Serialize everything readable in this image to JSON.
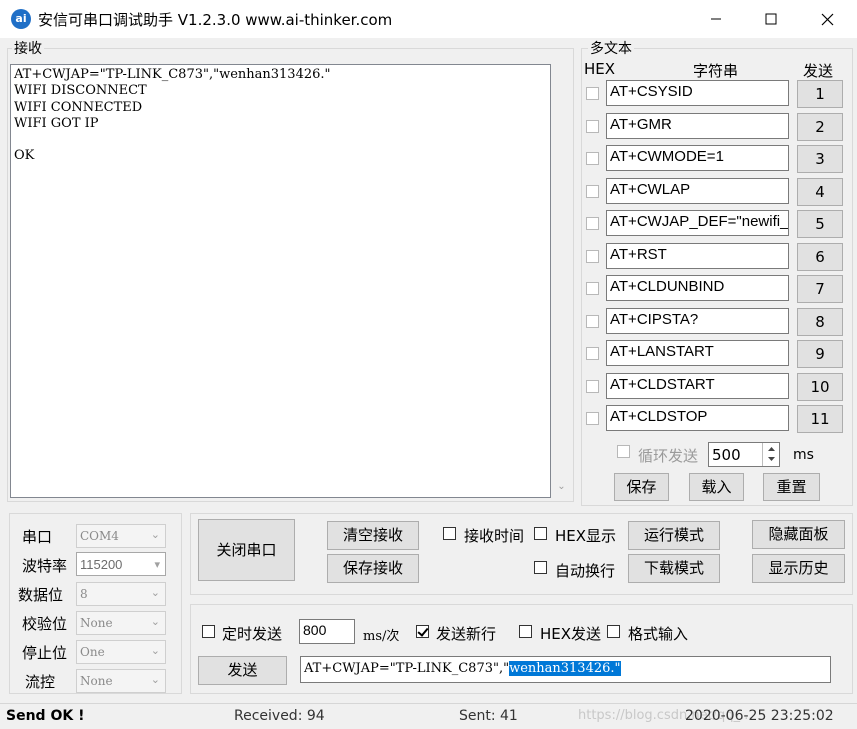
{
  "window": {
    "title": "安信可串口调试助手 V1.2.3.0    www.ai-thinker.com",
    "icon_text": "ai",
    "min_icon": "minimize-icon",
    "max_icon": "maximize-icon",
    "close_icon": "close-icon"
  },
  "receive": {
    "label": "接收",
    "content": "AT+CWJAP=\"TP-LINK_C873\",\"wenhan313426.\"\nWIFI DISCONNECT\nWIFI CONNECTED\nWIFI GOT IP\n\nOK"
  },
  "multi": {
    "label": "多文本",
    "hex_header": "HEX",
    "string_header": "字符串",
    "send_header": "发送",
    "items": [
      {
        "cmd": "AT+CSYSID",
        "num": "1"
      },
      {
        "cmd": "AT+GMR",
        "num": "2"
      },
      {
        "cmd": "AT+CWMODE=1",
        "num": "3"
      },
      {
        "cmd": "AT+CWLAP",
        "num": "4"
      },
      {
        "cmd": "AT+CWJAP_DEF=\"newifi_",
        "num": "5"
      },
      {
        "cmd": "AT+RST",
        "num": "6"
      },
      {
        "cmd": "AT+CLDUNBIND",
        "num": "7"
      },
      {
        "cmd": "AT+CIPSTA?",
        "num": "8"
      },
      {
        "cmd": "AT+LANSTART",
        "num": "9"
      },
      {
        "cmd": "AT+CLDSTART",
        "num": "10"
      },
      {
        "cmd": "AT+CLDSTOP",
        "num": "11"
      }
    ],
    "loop_label": "循环发送",
    "loop_value": "500",
    "loop_unit": "ms",
    "save_label": "保存",
    "load_label": "载入",
    "reset_label": "重置"
  },
  "port": {
    "port_label": "串口",
    "port_value": "COM4",
    "baud_label": "波特率",
    "baud_value": "115200",
    "data_label": "数据位",
    "data_value": "8",
    "parity_label": "校验位",
    "parity_value": "None",
    "stop_label": "停止位",
    "stop_value": "One",
    "flow_label": "流控",
    "flow_value": "None"
  },
  "controls": {
    "close_port": "关闭串口",
    "clear_recv": "清空接收",
    "save_recv": "保存接收",
    "recv_time": "接收时间",
    "hex_display": "HEX显示",
    "run_mode": "运行模式",
    "hide_panel": "隐藏面板",
    "auto_wrap": "自动换行",
    "download_mode": "下载模式",
    "show_history": "显示历史"
  },
  "send": {
    "timed_send": "定时发送",
    "interval": "800",
    "interval_unit": "ms/次",
    "newline": "发送新行",
    "newline_checked": true,
    "hex_send": "HEX发送",
    "format_input": "格式输入",
    "send_button": "发送",
    "input_prefix": "AT+CWJAP=\"TP-LINK_C873\",\"",
    "input_selected": "wenhan313426.\"",
    "selection_color": "#0078d7"
  },
  "status": {
    "result": "Send OK !",
    "received": "Received: 94",
    "sent": "Sent: 41",
    "watermark": "https://blog.csdn.net/qq_...",
    "datetime": "2020-06-25 23:25:02"
  }
}
